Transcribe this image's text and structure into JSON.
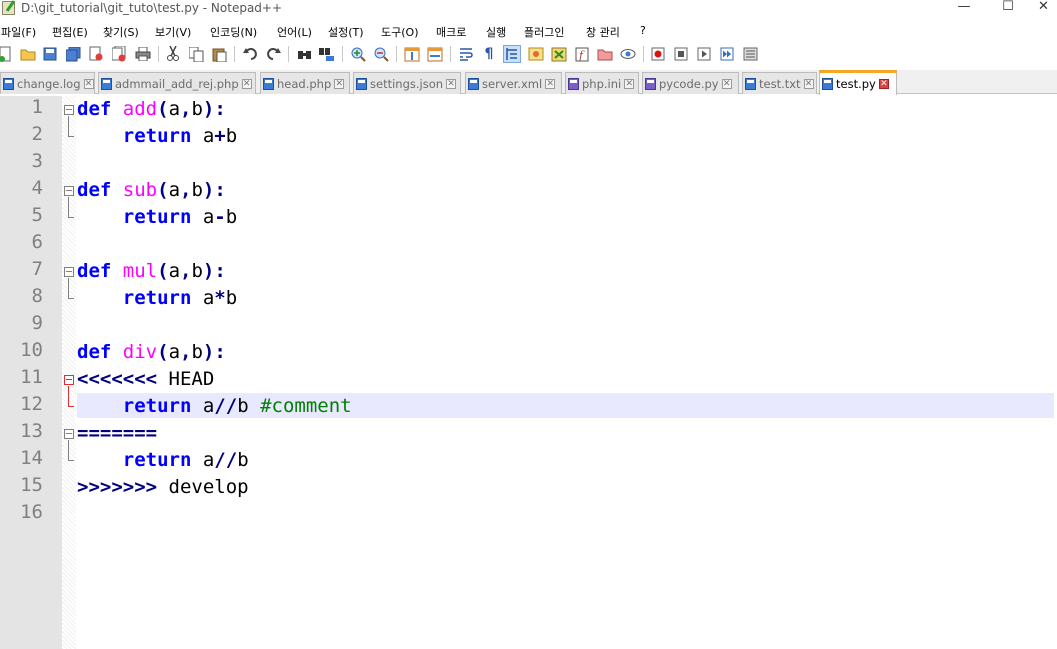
{
  "window": {
    "title": "D:\\git_tutorial\\git_tuto\\test.py - Notepad++",
    "minimize": "—",
    "maximize": "☐",
    "close": "✕"
  },
  "menu": [
    "파일(F)",
    "편집(E)",
    "찾기(S)",
    "보기(V)",
    "인코딩(N)",
    "언어(L)",
    "설정(T)",
    "도구(O)",
    "매크로",
    "실행",
    "플러그인",
    "창 관리",
    "?"
  ],
  "toolbar": [
    "new-file",
    "open-file",
    "save",
    "save-all",
    "close",
    "close-all",
    "print",
    "cut",
    "copy",
    "paste",
    "undo",
    "redo",
    "find",
    "replace",
    "zoom-in",
    "zoom-out",
    "sync-vertical",
    "sync-horizontal",
    "word-wrap",
    "show-all-chars",
    "indent-guide",
    "user-language",
    "doc-map",
    "function-list",
    "folder-as-workspace",
    "monitoring",
    "record-macro",
    "stop-recording",
    "playback-macro",
    "run-macro-multiple",
    "save-macro"
  ],
  "tabs": [
    {
      "label": "change.log",
      "active": false
    },
    {
      "label": "admmail_add_rej.php",
      "active": false
    },
    {
      "label": "head.php",
      "active": false
    },
    {
      "label": "settings.json",
      "active": false
    },
    {
      "label": "server.xml",
      "active": false
    },
    {
      "label": "php.ini",
      "active": false
    },
    {
      "label": "pycode.py",
      "active": false
    },
    {
      "label": "test.txt",
      "active": false
    },
    {
      "label": "test.py",
      "active": true
    }
  ],
  "editor": {
    "line_numbers": [
      "1",
      "2",
      "3",
      "4",
      "5",
      "6",
      "7",
      "8",
      "9",
      "10",
      "11",
      "12",
      "13",
      "14",
      "15",
      "16"
    ],
    "current_line": 12,
    "lines": [
      [
        {
          "t": "def",
          "c": "kw"
        },
        {
          "t": " ",
          "c": "tx"
        },
        {
          "t": "add",
          "c": "fn"
        },
        {
          "t": "(",
          "c": "op"
        },
        {
          "t": "a",
          "c": "tx"
        },
        {
          "t": ",",
          "c": "op"
        },
        {
          "t": "b",
          "c": "tx"
        },
        {
          "t": "):",
          "c": "op"
        }
      ],
      [
        {
          "t": "    ",
          "c": "tx"
        },
        {
          "t": "return",
          "c": "kw"
        },
        {
          "t": " a",
          "c": "tx"
        },
        {
          "t": "+",
          "c": "op"
        },
        {
          "t": "b",
          "c": "tx"
        }
      ],
      [],
      [
        {
          "t": "def",
          "c": "kw"
        },
        {
          "t": " ",
          "c": "tx"
        },
        {
          "t": "sub",
          "c": "fn"
        },
        {
          "t": "(",
          "c": "op"
        },
        {
          "t": "a",
          "c": "tx"
        },
        {
          "t": ",",
          "c": "op"
        },
        {
          "t": "b",
          "c": "tx"
        },
        {
          "t": "):",
          "c": "op"
        }
      ],
      [
        {
          "t": "    ",
          "c": "tx"
        },
        {
          "t": "return",
          "c": "kw"
        },
        {
          "t": " a",
          "c": "tx"
        },
        {
          "t": "-",
          "c": "op"
        },
        {
          "t": "b",
          "c": "tx"
        }
      ],
      [],
      [
        {
          "t": "def",
          "c": "kw"
        },
        {
          "t": " ",
          "c": "tx"
        },
        {
          "t": "mul",
          "c": "fn"
        },
        {
          "t": "(",
          "c": "op"
        },
        {
          "t": "a",
          "c": "tx"
        },
        {
          "t": ",",
          "c": "op"
        },
        {
          "t": "b",
          "c": "tx"
        },
        {
          "t": "):",
          "c": "op"
        }
      ],
      [
        {
          "t": "    ",
          "c": "tx"
        },
        {
          "t": "return",
          "c": "kw"
        },
        {
          "t": " a",
          "c": "tx"
        },
        {
          "t": "*",
          "c": "op"
        },
        {
          "t": "b",
          "c": "tx"
        }
      ],
      [],
      [
        {
          "t": "def",
          "c": "kw"
        },
        {
          "t": " ",
          "c": "tx"
        },
        {
          "t": "div",
          "c": "fn"
        },
        {
          "t": "(",
          "c": "op"
        },
        {
          "t": "a",
          "c": "tx"
        },
        {
          "t": ",",
          "c": "op"
        },
        {
          "t": "b",
          "c": "tx"
        },
        {
          "t": "):",
          "c": "op"
        }
      ],
      [
        {
          "t": "<<<<<<<",
          "c": "op"
        },
        {
          "t": " HEAD",
          "c": "tx"
        }
      ],
      [
        {
          "t": "    ",
          "c": "tx"
        },
        {
          "t": "return",
          "c": "kw"
        },
        {
          "t": " a",
          "c": "tx"
        },
        {
          "t": "//",
          "c": "op"
        },
        {
          "t": "b ",
          "c": "tx"
        },
        {
          "t": "#comment",
          "c": "cm"
        }
      ],
      [
        {
          "t": "=======",
          "c": "op"
        }
      ],
      [
        {
          "t": "    ",
          "c": "tx"
        },
        {
          "t": "return",
          "c": "kw"
        },
        {
          "t": " a",
          "c": "tx"
        },
        {
          "t": "//",
          "c": "op"
        },
        {
          "t": "b",
          "c": "tx"
        }
      ],
      [
        {
          "t": ">>>>>>>",
          "c": "op"
        },
        {
          "t": " develop",
          "c": "tx"
        }
      ],
      []
    ]
  }
}
